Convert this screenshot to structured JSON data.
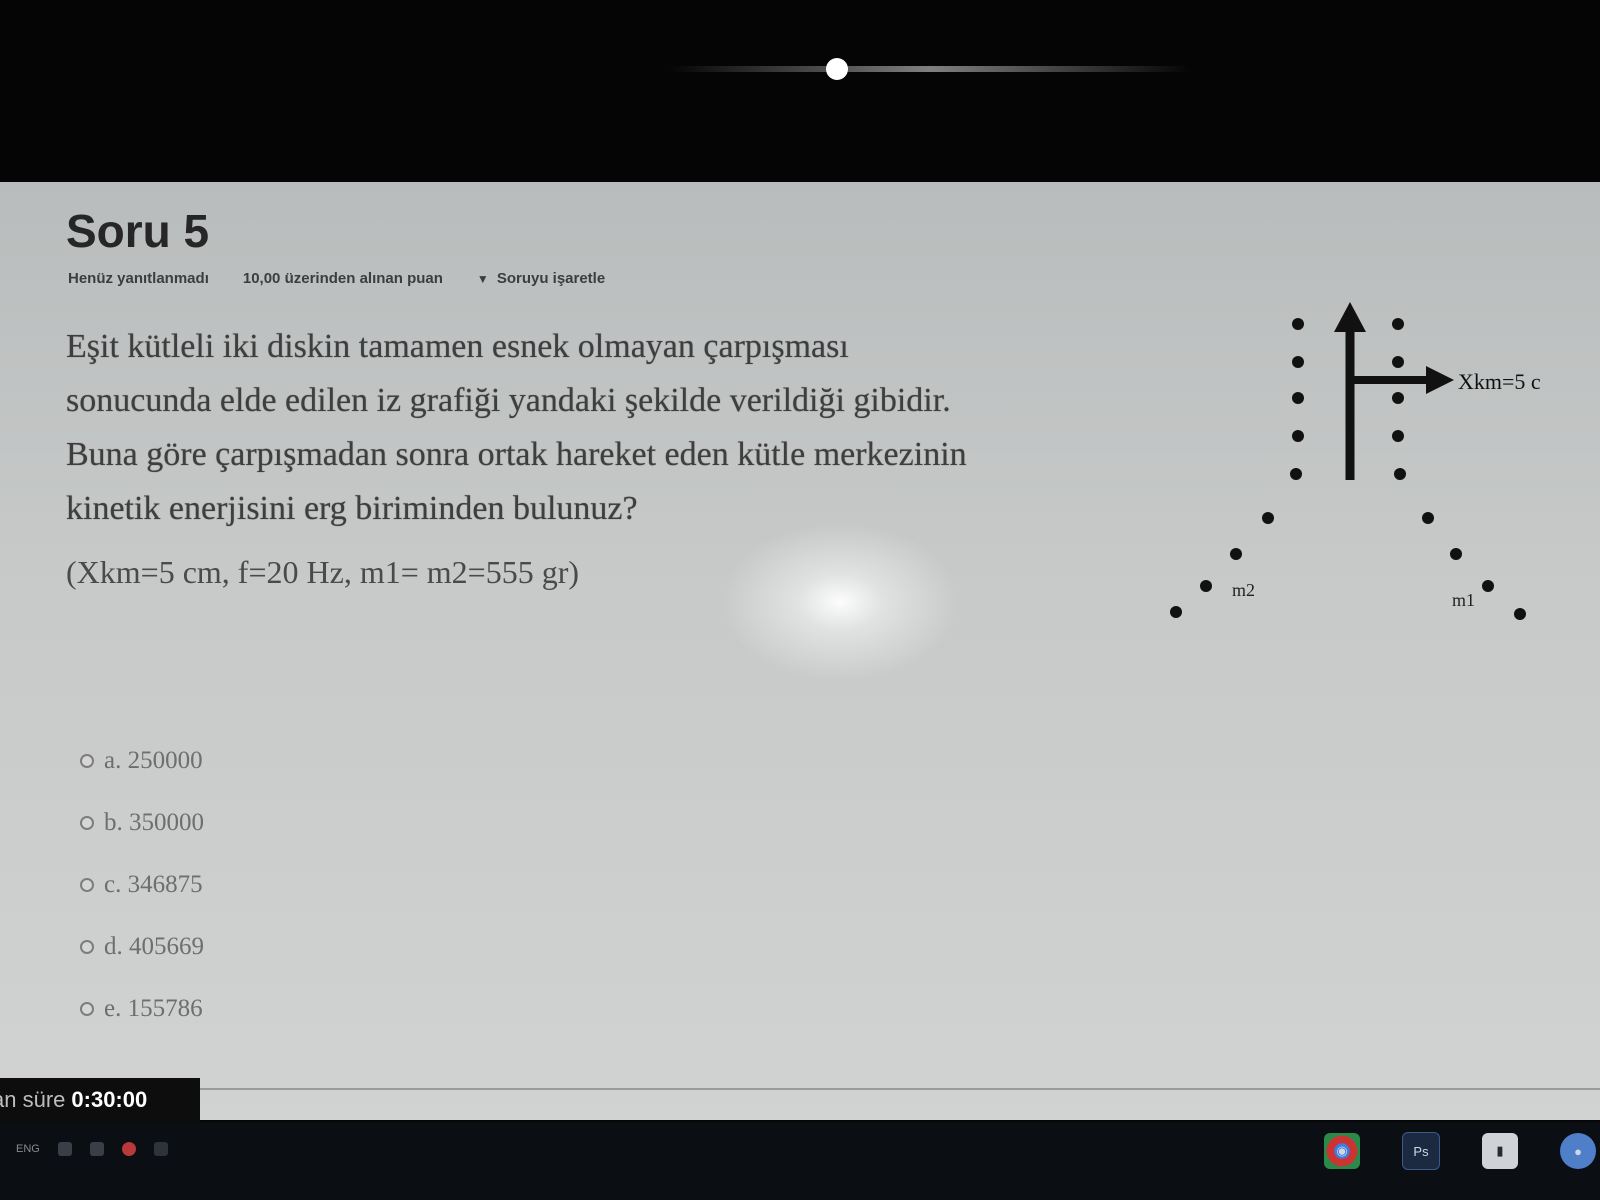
{
  "question": {
    "title": "Soru 5",
    "status": "Henüz yanıtlanmadı",
    "points": "10,00 üzerinden alınan puan",
    "flag_label": "Soruyu işaretle",
    "text_lines": [
      "Eşit kütleli iki diskin tamamen esnek olmayan çarpışması",
      "sonucunda elde edilen iz grafiği yandaki şekilde verildiği gibidir.",
      "Buna göre çarpışmadan sonra ortak hareket eden kütle merkezinin",
      "kinetik enerjisini erg biriminden bulunuz?"
    ],
    "given": "(Xkm=5 cm, f=20 Hz, m1= m2=555 gr)"
  },
  "figure": {
    "arrow_label": "Xkm=5 c",
    "mass_left": "m2",
    "mass_right": "m1"
  },
  "answers": [
    {
      "label": "a. 250000"
    },
    {
      "label": "b. 350000"
    },
    {
      "label": "c. 346875"
    },
    {
      "label": "d. 405669"
    },
    {
      "label": "e. 155786"
    }
  ],
  "timer": {
    "label": "an süre",
    "value": "0:30:00"
  },
  "taskbar": {
    "tray_text": "ENG",
    "apps": [
      {
        "name": "chrome-icon",
        "glyph": "◉"
      },
      {
        "name": "photoshop-icon",
        "glyph": "Ps"
      },
      {
        "name": "files-icon",
        "glyph": "▮"
      },
      {
        "name": "chat-icon",
        "glyph": "●"
      }
    ]
  }
}
